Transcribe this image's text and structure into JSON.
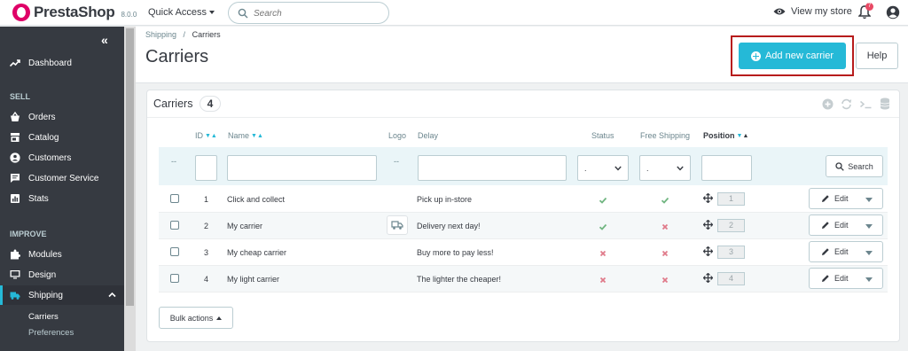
{
  "topbar": {
    "brand": "PrestaShop",
    "version": "8.0.0",
    "quick_access": "Quick Access",
    "search_placeholder": "Search",
    "view_store": "View my store",
    "notifications_count": "7"
  },
  "sidebar": {
    "items": [
      {
        "label": "Dashboard",
        "icon": "trending-up-icon"
      },
      {
        "label": "Orders",
        "icon": "basket-icon"
      },
      {
        "label": "Catalog",
        "icon": "store-icon"
      },
      {
        "label": "Customers",
        "icon": "person-icon"
      },
      {
        "label": "Customer Service",
        "icon": "chat-icon"
      },
      {
        "label": "Stats",
        "icon": "chart-icon"
      },
      {
        "label": "Modules",
        "icon": "puzzle-icon"
      },
      {
        "label": "Design",
        "icon": "monitor-icon"
      },
      {
        "label": "Shipping",
        "icon": "truck-icon"
      }
    ],
    "sections": [
      "SELL",
      "IMPROVE"
    ],
    "sub_items": [
      "Carriers",
      "Preferences"
    ]
  },
  "header": {
    "breadcrumb_parent": "Shipping",
    "breadcrumb_sep": "/",
    "breadcrumb_current": "Carriers",
    "title": "Carriers",
    "add_button": "Add new carrier",
    "help_button": "Help"
  },
  "card": {
    "title": "Carriers",
    "count": "4",
    "columns": {
      "id": "ID",
      "name": "Name",
      "logo": "Logo",
      "delay": "Delay",
      "status": "Status",
      "free_shipping": "Free Shipping",
      "position": "Position"
    },
    "filter": {
      "dash": "--",
      "select_placeholder": ".",
      "search_button": "Search"
    },
    "rows": [
      {
        "id": "1",
        "name": "Click and collect",
        "delay": "Pick up in-store",
        "status": true,
        "free": true,
        "position": "1",
        "edit": "Edit",
        "has_logo": false
      },
      {
        "id": "2",
        "name": "My carrier",
        "delay": "Delivery next day!",
        "status": true,
        "free": false,
        "position": "2",
        "edit": "Edit",
        "has_logo": true
      },
      {
        "id": "3",
        "name": "My cheap carrier",
        "delay": "Buy more to pay less!",
        "status": false,
        "free": false,
        "position": "3",
        "edit": "Edit",
        "has_logo": false
      },
      {
        "id": "4",
        "name": "My light carrier",
        "delay": "The lighter the cheaper!",
        "status": false,
        "free": false,
        "position": "4",
        "edit": "Edit",
        "has_logo": false
      }
    ],
    "bulk_actions": "Bulk actions"
  },
  "colors": {
    "accent": "#25b9d7",
    "sidebar_bg": "#363a41",
    "success": "#70b580",
    "danger": "#e07a8a",
    "highlight_border": "#b71c1c"
  }
}
